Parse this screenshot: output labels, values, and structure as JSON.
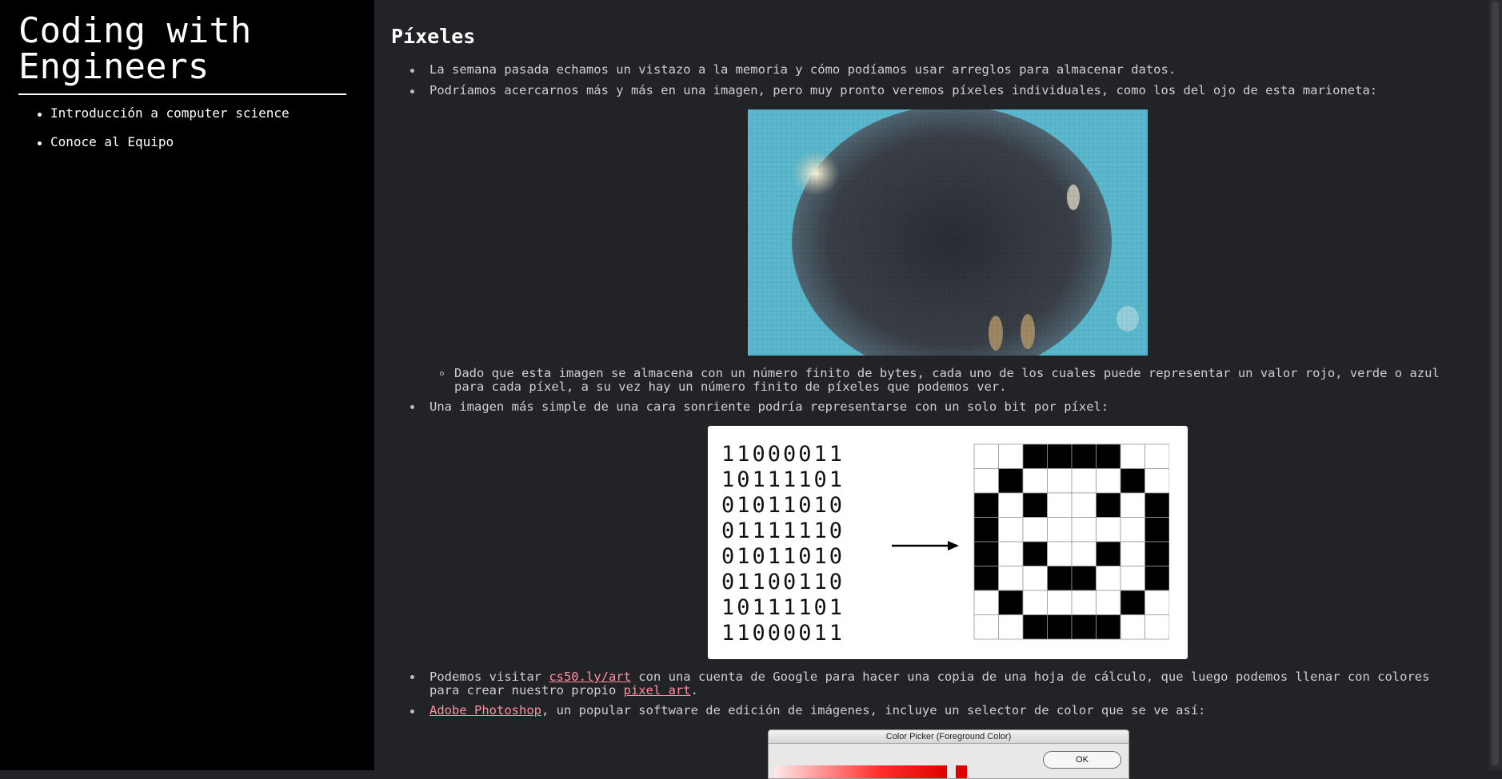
{
  "sidebar": {
    "title": "Coding with Engineers",
    "nav": [
      {
        "label": "Introducción a computer science"
      },
      {
        "label": "Conoce al Equipo"
      }
    ]
  },
  "main": {
    "heading": "Píxeles",
    "bullet1": "La semana pasada echamos un vistazo a la memoria y cómo podíamos usar arreglos para almacenar datos.",
    "bullet2": "Podríamos acercarnos más y más en una imagen, pero muy pronto veremos píxeles individuales, como los del ojo de esta marioneta:",
    "sub_line1": "Dado que esta imagen se almacena con un número finito de bytes, cada uno de los cuales puede representar un valor rojo, verde o azul",
    "sub_line2": "para cada píxel, a su vez hay un número finito de píxeles que podemos ver.",
    "bullet3": "Una imagen más simple de una cara sonriente podría representarse con un solo bit por píxel:",
    "bullet4_pre": "Podemos visitar ",
    "bullet4_link1": "cs50.ly/art",
    "bullet4_mid": " con una cuenta de Google para hacer una copia de una hoja de cálculo, que luego podemos llenar con colores",
    "bullet4_line2_pre": "para crear nuestro propio ",
    "bullet4_link2": "pixel art",
    "bullet4_line2_post": ".",
    "bullet5_link": "Adobe Photoshop",
    "bullet5_rest": ", un popular software de edición de imágenes, incluye un selector de color que se ve así:"
  },
  "smiley": {
    "rows": [
      "11000011",
      "10111101",
      "01011010",
      "01111110",
      "01011010",
      "01100110",
      "10111101",
      "11000011"
    ]
  },
  "picker": {
    "title": "Color Picker (Foreground Color)",
    "ok_label": "OK"
  },
  "colors": {
    "sidebar_bg": "#000000",
    "main_bg": "#222326",
    "link": "#ff8fa0"
  }
}
